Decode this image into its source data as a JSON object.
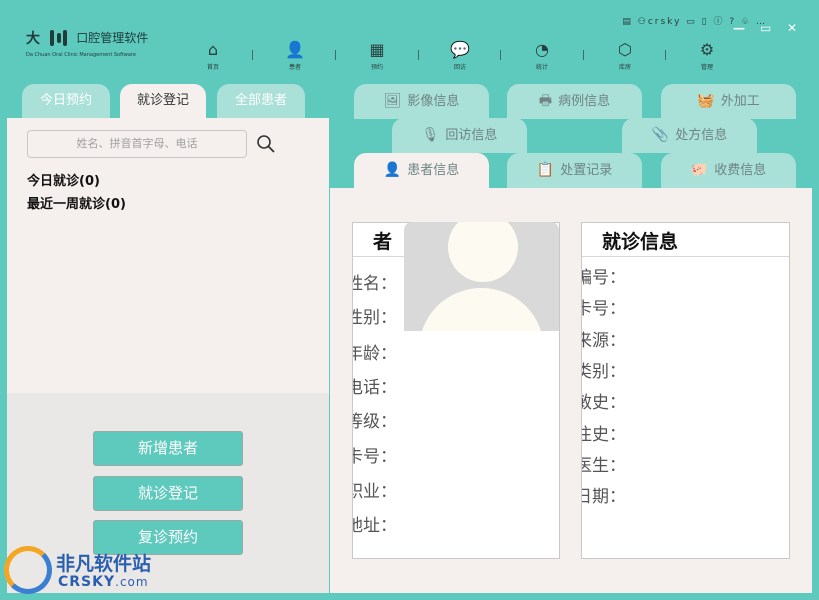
{
  "app": {
    "brand_big": "大",
    "name": "口腔管理软件",
    "subtitle": "Da Chuan Oral Clinic Management Software"
  },
  "nav": [
    {
      "label": "首页",
      "icon": "home-icon",
      "glyph": "⌂"
    },
    {
      "label": "患者",
      "icon": "user-icon",
      "glyph": "👤"
    },
    {
      "label": "预约",
      "icon": "calendar-icon",
      "glyph": "▦"
    },
    {
      "label": "回访",
      "icon": "chat-icon",
      "glyph": "💬"
    },
    {
      "label": "统计",
      "icon": "pie-chart-icon",
      "glyph": "◔"
    },
    {
      "label": "库房",
      "icon": "box-icon",
      "glyph": "⬡"
    },
    {
      "label": "管理",
      "icon": "gear-icon",
      "glyph": "⚙"
    }
  ],
  "system": {
    "user": "crsky",
    "minimize": "—",
    "maximize": "▭",
    "close": "✕"
  },
  "left_tabs": [
    "今日预约",
    "就诊登记",
    "全部患者"
  ],
  "search": {
    "placeholder": "姓名、拼音首字母、电话"
  },
  "visits": {
    "today": "今日就诊(0)",
    "week": "最近一周就诊(0)"
  },
  "buttons": {
    "add_patient": "新增患者",
    "register_visit": "就诊登记",
    "follow_up_appointment": "复诊预约"
  },
  "right_tabs": {
    "row1": [
      {
        "label": "影像信息",
        "icon": "image-icon",
        "glyph": "🖼"
      },
      {
        "label": "病例信息",
        "icon": "printer-icon",
        "glyph": "🖶"
      },
      {
        "label": "外加工",
        "icon": "basket-icon",
        "glyph": "🧺"
      }
    ],
    "row2": [
      {
        "label": "回访信息",
        "icon": "microphone-icon",
        "glyph": "🎙"
      },
      {
        "label": "处方信息",
        "icon": "paperclip-icon",
        "glyph": "📎"
      }
    ],
    "row3": [
      {
        "label": "患者信息",
        "icon": "user-icon",
        "glyph": "👤"
      },
      {
        "label": "处置记录",
        "icon": "clipboard-icon",
        "glyph": "📋"
      },
      {
        "label": "收费信息",
        "icon": "piggy-bank-icon",
        "glyph": "🐖"
      }
    ]
  },
  "patient_card": {
    "title_visible": "者",
    "fields": [
      "姓名：",
      "性别：",
      "年龄：",
      "电话：",
      "等级：",
      "卡号：",
      "职业：",
      "地址："
    ]
  },
  "visit_card": {
    "title": "就诊信息",
    "fields": [
      "编号：",
      "卡号：",
      "来源：",
      "类别：",
      "敏史：",
      "往史：",
      "医生：",
      "日期："
    ]
  },
  "watermark": {
    "text": "非凡软件站",
    "url_main": "CRSKY",
    "url_suffix": ".com"
  },
  "colors": {
    "accent": "#5ec9bd",
    "tab_inactive": "#a9e0d8",
    "panel": "#f5f0ee"
  }
}
